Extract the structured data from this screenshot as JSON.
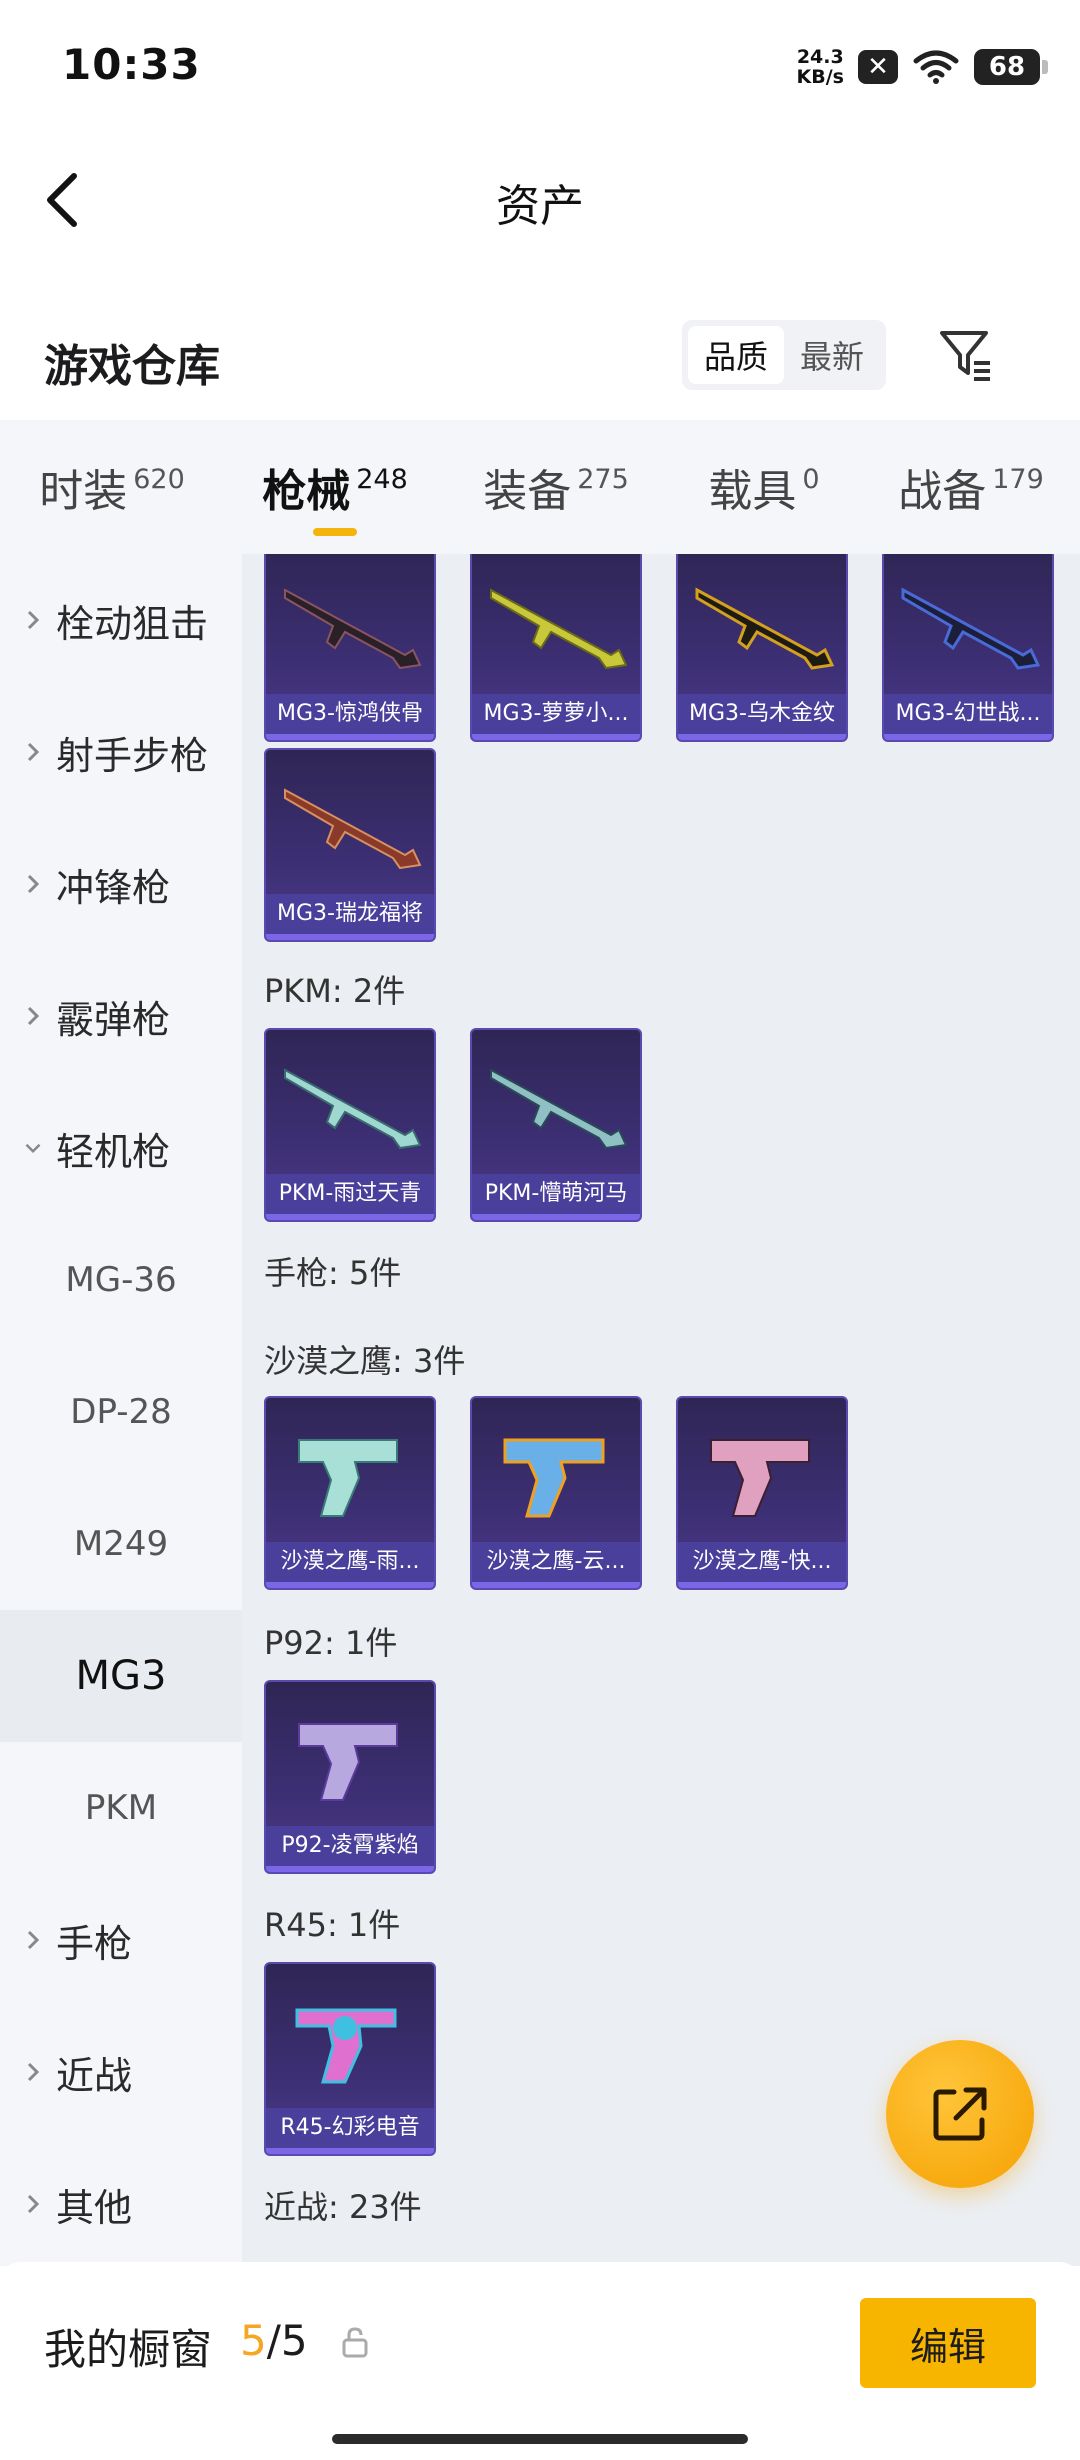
{
  "status_bar": {
    "time": "10:33",
    "net_speed_value": "24.3",
    "net_speed_unit": "KB/s",
    "battery": "68"
  },
  "nav": {
    "title": "资产"
  },
  "warehouse": {
    "title": "游戏仓库",
    "sort_options": [
      "品质",
      "最新"
    ],
    "sort_active": "品质"
  },
  "tabs": [
    {
      "label": "时装",
      "count": "620"
    },
    {
      "label": "枪械",
      "count": "248"
    },
    {
      "label": "装备",
      "count": "275"
    },
    {
      "label": "载具",
      "count": "0"
    },
    {
      "label": "战备",
      "count": "179"
    }
  ],
  "active_tab": "枪械",
  "sidebar": {
    "cat1": "栓动狙击",
    "cat2": "射手步枪",
    "cat3": "冲锋枪",
    "cat4": "霰弹枪",
    "cat5": "轻机枪",
    "sub1": "MG-36",
    "sub2": "DP-28",
    "sub3": "M249",
    "sub4": "MG3",
    "sub5": "PKM",
    "cat6": "手枪",
    "cat7": "近战",
    "cat8": "其他",
    "active_sub": "MG3"
  },
  "content": {
    "row1": [
      "MG3-惊鸿侠骨",
      "MG3-萝萝小...",
      "MG3-乌木金纹",
      "MG3-幻世战..."
    ],
    "mg3_last": "MG3-瑞龙福将",
    "pkm_header": "PKM: 2件",
    "pkm_items": [
      "PKM-雨过天青",
      "PKM-懵萌河马"
    ],
    "pistol_header": "手枪: 5件",
    "deagle_header": "沙漠之鹰: 3件",
    "deagle_items": [
      "沙漠之鹰-雨...",
      "沙漠之鹰-云...",
      "沙漠之鹰-快..."
    ],
    "p92_header": "P92: 1件",
    "p92_items": [
      "P92-凌霄紫焰"
    ],
    "r45_header": "R45: 1件",
    "r45_items": [
      "R45-幻彩电音"
    ],
    "melee_header": "近战: 23件"
  },
  "bottom": {
    "showcase_title": "我的橱窗",
    "showcase_used": "5",
    "showcase_sep": "/",
    "showcase_total": "5",
    "edit_label": "编辑"
  },
  "colors": {
    "accent": "#f8b500",
    "card_bg": "#3d2f74",
    "card_caption": "#4a3f9a"
  },
  "icons": {
    "back": "chevron-left-icon",
    "filter": "filter-icon",
    "fab": "share-icon",
    "lock": "lock-icon"
  }
}
